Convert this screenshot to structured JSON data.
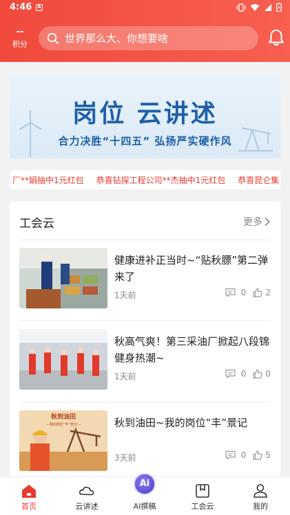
{
  "status": {
    "time": "4:46",
    "indicator": "A"
  },
  "header": {
    "points_value": "--",
    "points_label": "积分",
    "search_placeholder": "世界那么大、你想要啥"
  },
  "banner": {
    "title": "岗位 云讲述",
    "subtitle": "合力决胜“十四五”  弘扬严实硬作风"
  },
  "ticker": {
    "items": [
      "厂**娟抽中1元红包",
      "恭喜钻探工程公司**杰抽中1元红包",
      "恭喜昆仑集"
    ]
  },
  "union": {
    "title": "工会云",
    "more_label": "更多",
    "news": [
      {
        "title": "健康进补正当时~“贴秋膘”第二弹来了",
        "time": "1天前",
        "comments": "0",
        "likes": "2"
      },
      {
        "title": "秋高气爽！第三采油厂掀起八段锦健身热潮~",
        "time": "1天前",
        "comments": "0",
        "likes": "0"
      },
      {
        "title": "秋到油田~我的岗位“丰”景记",
        "time": "3天前",
        "comments": "0",
        "likes": "5",
        "thumb_caption_1": "秋到油田",
        "thumb_caption_2": "—我的岗位“丰”景记—"
      }
    ]
  },
  "nav": {
    "items": [
      {
        "label": "首页",
        "icon": "home-icon",
        "active": true
      },
      {
        "label": "云讲述",
        "icon": "cloud-icon",
        "active": false
      },
      {
        "label": "AI撰稿",
        "icon": "ai-icon",
        "badge": "Ai",
        "active": false
      },
      {
        "label": "工会云",
        "icon": "bookmark-icon",
        "active": false
      },
      {
        "label": "我的",
        "icon": "user-icon",
        "active": false
      }
    ]
  },
  "colors": {
    "brand_red": "#f04a3c",
    "banner_blue": "#1f5fa8",
    "ticker_red": "#e83a2e",
    "ai_purple": "#5b4ed8"
  }
}
